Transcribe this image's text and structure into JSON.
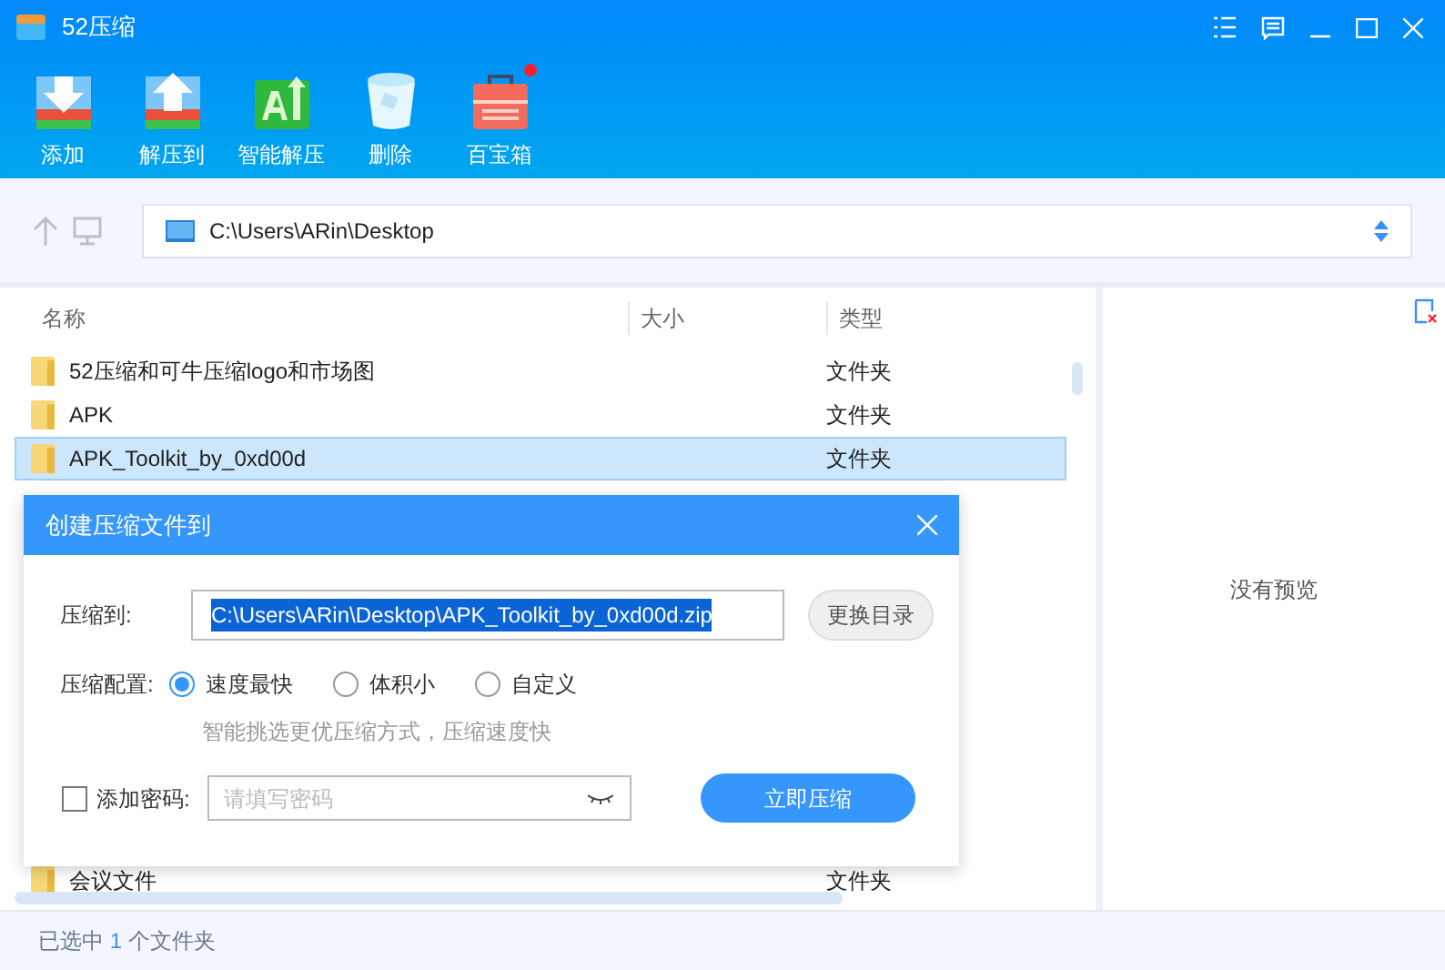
{
  "window": {
    "title": "52压缩"
  },
  "toolbar": [
    {
      "label": "添加",
      "kind": "add"
    },
    {
      "label": "解压到",
      "kind": "extract"
    },
    {
      "label": "智能解压",
      "kind": "smart"
    },
    {
      "label": "删除",
      "kind": "delete"
    },
    {
      "label": "百宝箱",
      "kind": "toolbox",
      "badge": true
    }
  ],
  "address": {
    "path": "C:\\Users\\ARin\\Desktop"
  },
  "table": {
    "columns": [
      "名称",
      "大小",
      "类型"
    ],
    "rows": [
      {
        "name": "52压缩和可牛压缩logo和市场图",
        "type": "文件夹",
        "selected": false
      },
      {
        "name": "APK",
        "type": "文件夹",
        "selected": false
      },
      {
        "name": "APK_Toolkit_by_0xd00d",
        "type": "文件夹",
        "selected": true
      }
    ],
    "last_row": {
      "name": "会议文件",
      "type": "文件夹",
      "selected": false
    }
  },
  "preview": {
    "text": "没有预览"
  },
  "status_bar": {
    "prefix": "已选中",
    "count": "1",
    "suffix": "个文件夹"
  },
  "dialog": {
    "title": "创建压缩文件到",
    "target_label": "压缩到:",
    "target_value": "C:\\Users\\ARin\\Desktop\\APK_Toolkit_by_0xd00d.zip",
    "change_button": "更换目录",
    "config_label": "压缩配置:",
    "options": [
      {
        "label": "速度最快",
        "selected": true
      },
      {
        "label": "体积小",
        "selected": false
      },
      {
        "label": "自定义",
        "selected": false
      }
    ],
    "hint": "智能挑选更优压缩方式，压缩速度快",
    "password": {
      "label": "添加密码:",
      "checked": false,
      "placeholder": "请填写密码"
    },
    "submit": "立即压缩"
  }
}
